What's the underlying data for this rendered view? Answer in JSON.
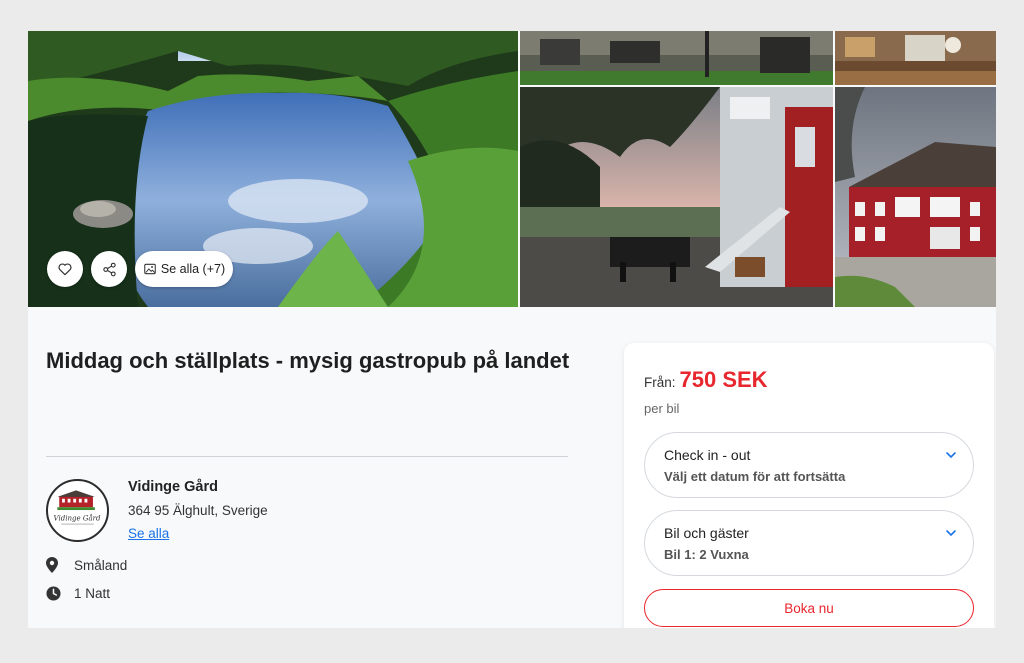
{
  "gallery": {
    "see_all_label": "Se alla (+7)"
  },
  "listing": {
    "title": "Middag och ställplats - mysig gastropub på landet"
  },
  "host": {
    "name": "Vidinge Gård",
    "address": "364 95 Älghult, Sverige",
    "see_all_link": "Se alla",
    "logo_text": "Vidinge Gård"
  },
  "meta": {
    "region": "Småland",
    "nights": "1 Natt"
  },
  "booking": {
    "price_prefix": "Från:",
    "price": "750 SEK",
    "per_unit": "per bil",
    "dates": {
      "label": "Check in - out",
      "value": "Välj ett datum för att fortsätta"
    },
    "guests": {
      "label": "Bil och gäster",
      "value": "Bil 1: 2 Vuxna"
    },
    "book_button": "Boka nu"
  },
  "colors": {
    "accent": "#e8262d",
    "link": "#1a73e8"
  }
}
